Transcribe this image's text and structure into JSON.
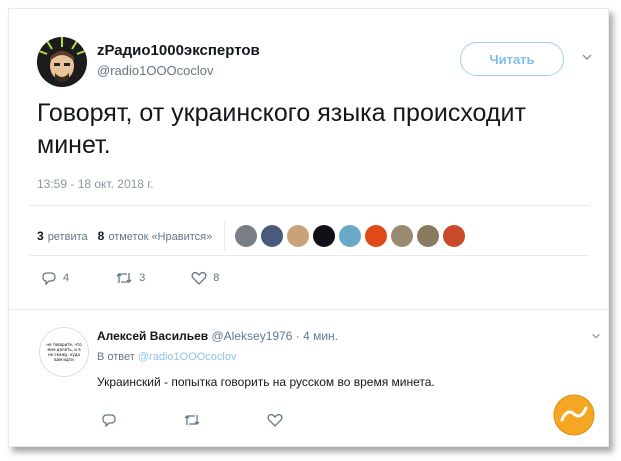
{
  "tweet": {
    "author_name": "zРадио1000экспертов",
    "author_handle": "@radio1OOOcoclov",
    "follow_label": "Читать",
    "text": "Говорят, от украинского языка происходит минет.",
    "timestamp": "13:59 - 18 окт. 2018 г.",
    "stats": {
      "retweets_count": "3",
      "retweets_label": "ретвита",
      "likes_count": "8",
      "likes_label": "отметок «Нравится»"
    },
    "liker_colors": [
      "#7a7f86",
      "#4a5a7a",
      "#c9a27a",
      "#101018",
      "#6aa8c9",
      "#e04a1a",
      "#9a8a70",
      "#8a7a60",
      "#c94a2a"
    ],
    "actions": {
      "reply_count": "4",
      "retweet_count": "3",
      "like_count": "8"
    }
  },
  "reply": {
    "author_name": "Алексей Васильев",
    "author_handle": "@Aleksey1976",
    "time": "· 4 мин.",
    "in_reply_prefix": "В ответ",
    "in_reply_handle": "@radio1OOOcoclov",
    "text": "Украинский - попытка говорить на русском во время минета.",
    "avatar_text": "не говорите, что мне делать, и я не скажу, куда вам идти",
    "actions": {
      "reply_count": "",
      "retweet_count": "",
      "like_count": ""
    }
  },
  "icons": {
    "reply": "reply-icon",
    "retweet": "retweet-icon",
    "like": "heart-icon",
    "menu": "chevron-down-icon"
  },
  "colors": {
    "accent": "#1da1f2",
    "muted": "#657786",
    "watermark": "#f29a1f"
  }
}
